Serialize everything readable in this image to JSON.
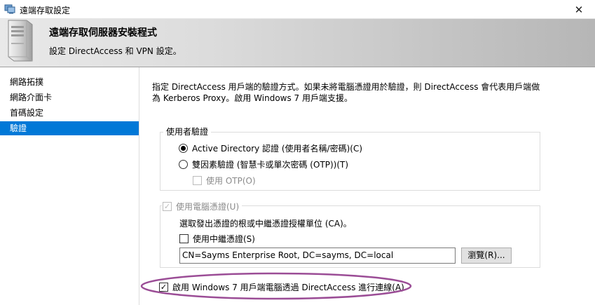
{
  "window": {
    "title": "遠端存取設定",
    "close_glyph": "✕"
  },
  "header": {
    "title": "遠端存取伺服器安裝程式",
    "subtitle": "設定 DirectAccess 和 VPN 設定。"
  },
  "sidebar": {
    "items": [
      {
        "label": "網路拓撲",
        "selected": false
      },
      {
        "label": "網路介面卡",
        "selected": false
      },
      {
        "label": "首碼設定",
        "selected": false
      },
      {
        "label": "驗證",
        "selected": true
      }
    ]
  },
  "content": {
    "description": "指定 DirectAccess 用戶端的驗證方式。如果未將電腦憑證用於驗證，則 DirectAccess 會代表用戶端做為 Kerberos Proxy。啟用 Windows 7 用戶端支援。",
    "user_auth": {
      "legend": "使用者驗證",
      "option_ad": "Active Directory 認證 (使用者名稱/密碼)(C)",
      "option_2fa": "雙因素驗證 (智慧卡或單次密碼 (OTP))(T)",
      "use_otp": "使用 OTP(O)"
    },
    "computer_cert": {
      "legend": "使用電腦憑證(U)",
      "instruction": "選取發出憑證的根或中繼憑證授權單位 (CA)。",
      "use_intermediate": "使用中繼憑證(S)",
      "ca_value": "CN=Sayms Enterprise Root, DC=sayms, DC=local",
      "browse_label": "瀏覽(R)..."
    },
    "win7_support": "啟用 Windows 7 用戶端電腦透過 DirectAccess 進行連線(A)"
  },
  "colors": {
    "selection": "#0078d7",
    "annotation_oval": "#9b4d96"
  },
  "icons": {
    "app": "remote-access-app-icon",
    "server": "server-tower-icon",
    "check": "✓"
  }
}
